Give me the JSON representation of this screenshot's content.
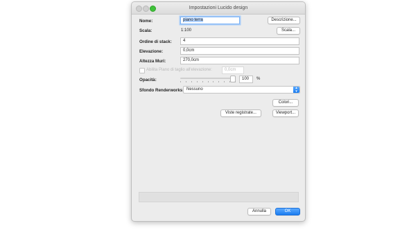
{
  "window": {
    "title": "Impostazioni Lucido design"
  },
  "name": {
    "label": "Nome:",
    "value": "piano terra",
    "button": "Descrizione..."
  },
  "scale": {
    "label": "Scala:",
    "value": "1:100",
    "button": "Scala..."
  },
  "stack_order": {
    "label": "Ordine di stack:",
    "value": "4"
  },
  "elevation": {
    "label": "Elevazione:",
    "value": "0,0cm"
  },
  "wall_height": {
    "label": "Altezza Muri:",
    "value": "270,0cm"
  },
  "cut_plane": {
    "label": "Abilita Piano di taglio all'elevazione:",
    "value": "0,0cm",
    "checked": false
  },
  "opacity": {
    "label": "Opacità:",
    "value": "100",
    "unit": "%",
    "level_percent": 100
  },
  "renderworks": {
    "label": "Sfondo Renderworks:",
    "selected": "Nessuno"
  },
  "buttons": {
    "colors": "Colori...",
    "saved_views": "Viste registrate...",
    "viewport": "Viewport...",
    "cancel": "Annulla",
    "ok": "OK"
  },
  "colors": {
    "accent": "#1b7df0",
    "close_light": "#3fc23a"
  }
}
